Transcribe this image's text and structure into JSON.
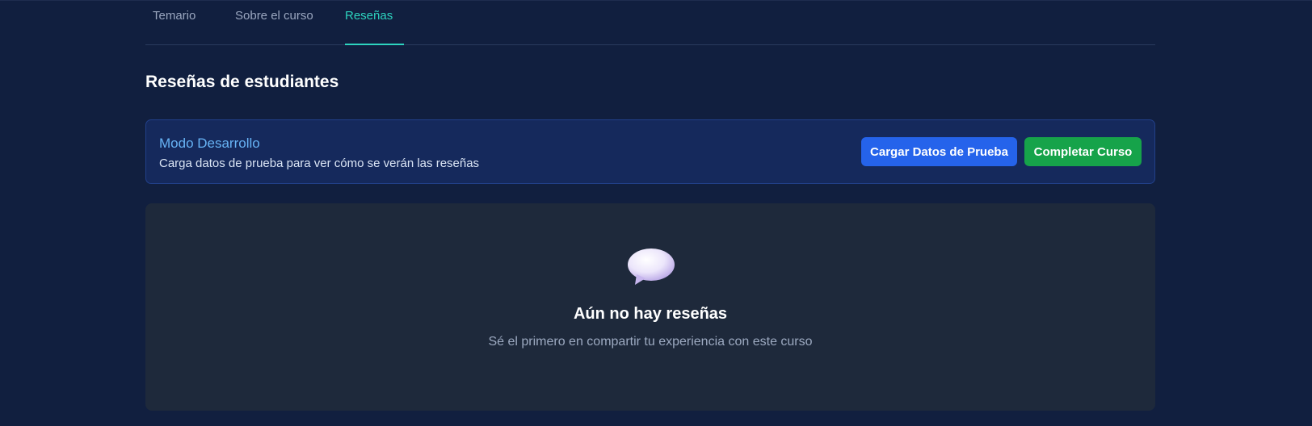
{
  "tabs": [
    {
      "label": "Temario",
      "active": false
    },
    {
      "label": "Sobre el curso",
      "active": false
    },
    {
      "label": "Reseñas",
      "active": true
    }
  ],
  "section": {
    "title": "Reseñas de estudiantes"
  },
  "dev_banner": {
    "title": "Modo Desarrollo",
    "description": "Carga datos de prueba para ver cómo se verán las reseñas",
    "load_button": "Cargar Datos de Prueba",
    "complete_button": "Completar Curso"
  },
  "empty_state": {
    "icon": "speech-bubble-icon",
    "title": "Aún no hay reseñas",
    "subtitle": "Sé el primero en compartir tu experiencia con este curso"
  },
  "colors": {
    "background": "#111f3f",
    "active_tab": "#2dd4bf",
    "load_button": "#2563eb",
    "complete_button": "#16a34a",
    "banner_title": "#67b3f5"
  }
}
